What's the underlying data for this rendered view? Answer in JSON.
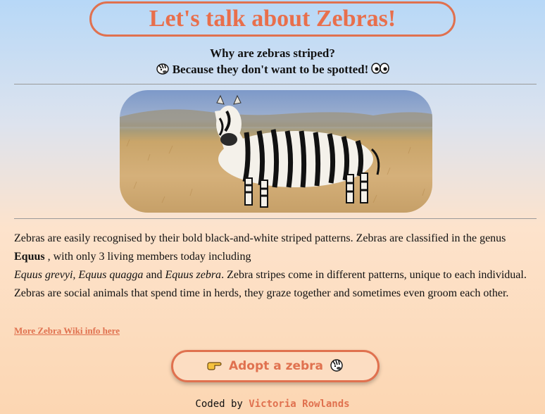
{
  "header": {
    "title": "Let's talk about Zebras!"
  },
  "joke": {
    "question": "Why are zebras striped?",
    "answer": "Because they don't want to be spotted!",
    "leading_icon": "zebra-face-icon",
    "trailing_icon": "eyes-icon"
  },
  "photo": {
    "subject": "zebra-standing-in-savanna"
  },
  "article": {
    "p1": "Zebras are easily recognised by their bold black-and-white striped patterns. Zebras are classified in the genus ",
    "genus": "Equus",
    "p2": " , with only 3 living members today including ",
    "species1": "Equus grevyi,",
    "species2": "Equus quagga",
    "and": " and ",
    "species3": "Equus zebra",
    "p3": ". Zebra stripes come in different patterns, unique to each individual. Zebras are social animals that spend time in herds, they graze together and sometimes even groom each other."
  },
  "links": {
    "wiki": "More Zebra Wiki info here"
  },
  "cta": {
    "label": "Adopt a zebra",
    "left_icon": "pointing-hand-icon",
    "right_icon": "zebra-face-icon"
  },
  "footer": {
    "prefix": "Coded by",
    "author": "Victoria Rowlands"
  },
  "colors": {
    "accent": "#e0714f",
    "sky": "#b7d8f7",
    "peach": "#fcd6b2"
  }
}
